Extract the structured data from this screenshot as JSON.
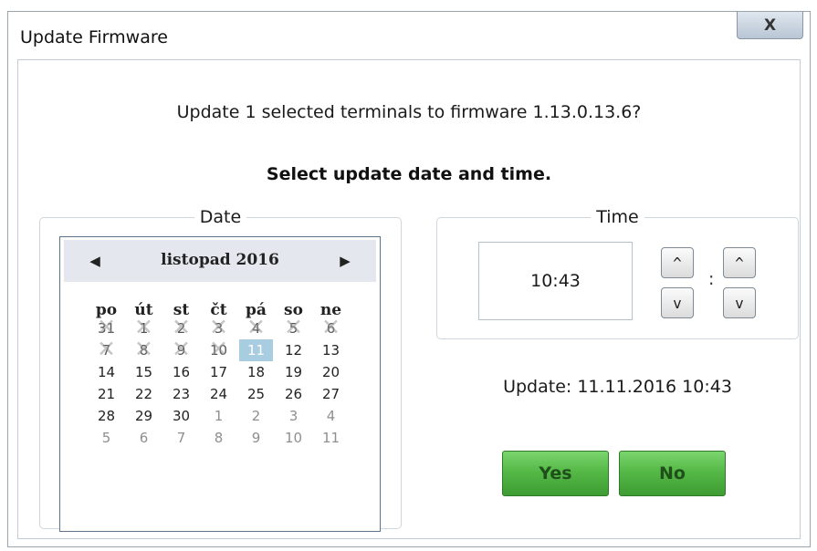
{
  "window": {
    "title": "Update Firmware",
    "close_label": "X"
  },
  "dialog": {
    "question": "Update 1 selected terminals to firmware 1.13.0.13.6?",
    "select_heading": "Select update date and time."
  },
  "date_group": {
    "label": "Date",
    "calendar": {
      "month_label": "listopad 2016",
      "prev_icon": "◀",
      "next_icon": "▶",
      "weekdays": [
        "po",
        "út",
        "st",
        "čt",
        "pá",
        "so",
        "ne"
      ],
      "weeks": [
        [
          {
            "d": "31",
            "s": "blackout"
          },
          {
            "d": "1",
            "s": "blackout"
          },
          {
            "d": "2",
            "s": "blackout"
          },
          {
            "d": "3",
            "s": "blackout"
          },
          {
            "d": "4",
            "s": "blackout"
          },
          {
            "d": "5",
            "s": "blackout"
          },
          {
            "d": "6",
            "s": "blackout"
          }
        ],
        [
          {
            "d": "7",
            "s": "blackout"
          },
          {
            "d": "8",
            "s": "blackout"
          },
          {
            "d": "9",
            "s": "blackout"
          },
          {
            "d": "10",
            "s": "blackout"
          },
          {
            "d": "11",
            "s": "selected"
          },
          {
            "d": "12",
            "s": "normal"
          },
          {
            "d": "13",
            "s": "normal"
          }
        ],
        [
          {
            "d": "14",
            "s": "normal"
          },
          {
            "d": "15",
            "s": "normal"
          },
          {
            "d": "16",
            "s": "normal"
          },
          {
            "d": "17",
            "s": "normal"
          },
          {
            "d": "18",
            "s": "normal"
          },
          {
            "d": "19",
            "s": "normal"
          },
          {
            "d": "20",
            "s": "normal"
          }
        ],
        [
          {
            "d": "21",
            "s": "normal"
          },
          {
            "d": "22",
            "s": "normal"
          },
          {
            "d": "23",
            "s": "normal"
          },
          {
            "d": "24",
            "s": "normal"
          },
          {
            "d": "25",
            "s": "normal"
          },
          {
            "d": "26",
            "s": "normal"
          },
          {
            "d": "27",
            "s": "normal"
          }
        ],
        [
          {
            "d": "28",
            "s": "normal"
          },
          {
            "d": "29",
            "s": "normal"
          },
          {
            "d": "30",
            "s": "normal"
          },
          {
            "d": "1",
            "s": "other"
          },
          {
            "d": "2",
            "s": "other"
          },
          {
            "d": "3",
            "s": "other"
          },
          {
            "d": "4",
            "s": "other"
          }
        ],
        [
          {
            "d": "5",
            "s": "other"
          },
          {
            "d": "6",
            "s": "other"
          },
          {
            "d": "7",
            "s": "other"
          },
          {
            "d": "8",
            "s": "other"
          },
          {
            "d": "9",
            "s": "other"
          },
          {
            "d": "10",
            "s": "other"
          },
          {
            "d": "11",
            "s": "other"
          }
        ]
      ]
    }
  },
  "time_group": {
    "label": "Time",
    "value": "10:43",
    "colon": ":",
    "up_icon": "^",
    "down_icon": "v"
  },
  "summary": "Update: 11.11.2016 10:43",
  "buttons": {
    "yes_label": "Yes",
    "no_label": "No"
  },
  "colors": {
    "button_green": "#55b947",
    "selected_day": "#a9cde0",
    "calendar_header": "#e4e8ee"
  }
}
